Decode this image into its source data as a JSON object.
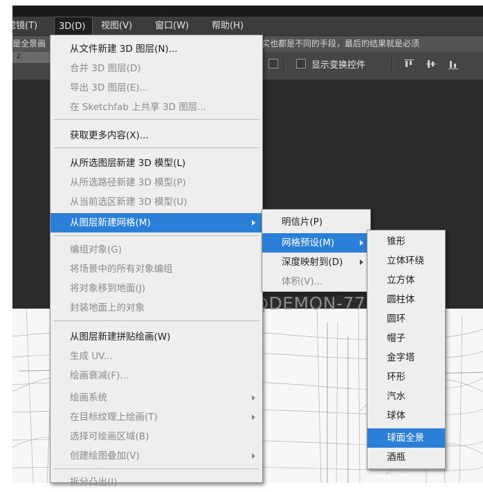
{
  "menubar": {
    "items": [
      {
        "label": "滤镜(T)"
      },
      {
        "label": "3D(D)"
      },
      {
        "label": "视图(V)"
      },
      {
        "label": "窗口(W)"
      },
      {
        "label": "帮助(H)"
      }
    ]
  },
  "docbar": {
    "left_text": "是全景画",
    "right_text": "实也都是不同的手段，最后的结果就是必须"
  },
  "ruler": {
    "label": "2"
  },
  "options": {
    "show_transform_label": "显示变换控件"
  },
  "watermark": "@DEMON-77",
  "menu_3d": {
    "items": [
      {
        "label": "从文件新建 3D 图层(N)...",
        "enabled": true
      },
      {
        "label": "合并 3D 图层(D)",
        "enabled": false
      },
      {
        "label": "导出 3D 图层(E)...",
        "enabled": false
      },
      {
        "label": "在 Sketchfab 上共享 3D 图层...",
        "enabled": false
      },
      {
        "label": "获取更多内容(X)...",
        "enabled": true
      },
      {
        "label": "从所选图层新建 3D 模型(L)",
        "enabled": true
      },
      {
        "label": "从所选路径新建 3D 模型(P)",
        "enabled": false
      },
      {
        "label": "从当前选区新建 3D 模型(U)",
        "enabled": false
      },
      {
        "label": "从图层新建网格(M)",
        "enabled": true,
        "highlighted": true,
        "submenu": true
      },
      {
        "label": "编组对象(G)",
        "enabled": false
      },
      {
        "label": "将场景中的所有对象编组",
        "enabled": false
      },
      {
        "label": "将对象移到地面(J)",
        "enabled": false
      },
      {
        "label": "封装地面上的对象",
        "enabled": false
      },
      {
        "label": "从图层新建拼贴绘画(W)",
        "enabled": true
      },
      {
        "label": "生成 UV...",
        "enabled": false
      },
      {
        "label": "绘画衰减(F)...",
        "enabled": false
      },
      {
        "label": "绘画系统",
        "enabled": false,
        "submenu": true
      },
      {
        "label": "在目标纹理上绘画(T)",
        "enabled": false,
        "submenu": true
      },
      {
        "label": "选择可绘画区域(B)",
        "enabled": false
      },
      {
        "label": "创建绘图叠加(V)",
        "enabled": false,
        "submenu": true
      },
      {
        "label": "拆分凸出(I)",
        "enabled": false
      }
    ]
  },
  "menu_mesh": {
    "items": [
      {
        "label": "明信片(P)",
        "enabled": true
      },
      {
        "label": "网格预设(M)",
        "enabled": true,
        "highlighted": true,
        "submenu": true
      },
      {
        "label": "深度映射到(D)",
        "enabled": true,
        "submenu": true
      },
      {
        "label": "体积(V)...",
        "enabled": false
      }
    ]
  },
  "menu_preset": {
    "items": [
      {
        "label": "锥形"
      },
      {
        "label": "立体环绕"
      },
      {
        "label": "立方体"
      },
      {
        "label": "圆柱体"
      },
      {
        "label": "圆环"
      },
      {
        "label": "帽子"
      },
      {
        "label": "金字塔"
      },
      {
        "label": "环形"
      },
      {
        "label": "汽水"
      },
      {
        "label": "球体"
      },
      {
        "label": "球面全景",
        "highlighted": true
      },
      {
        "label": "酒瓶"
      }
    ]
  },
  "colors": {
    "highlight": "#2b7fd6",
    "menu_bg": "#eeeeee",
    "app_dark": "#2b2b2b"
  }
}
